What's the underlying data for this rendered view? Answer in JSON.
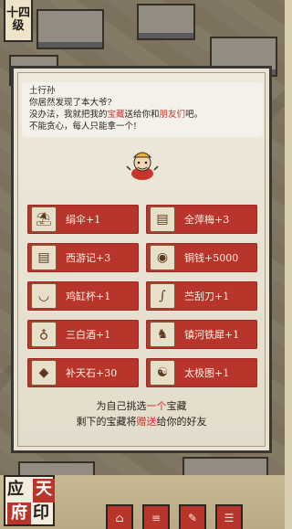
{
  "level_badge": {
    "line1": "十四",
    "line2": "级"
  },
  "dialog": {
    "speaker": "土行孙",
    "line1": "你居然发现了本大爷?",
    "line2_a": "没办法，我就把我的",
    "line2_red1": "宝藏",
    "line2_b": "送给你和",
    "line2_red2": "朋友们",
    "line2_c": "吧。",
    "line3": "不能贪心，每人只能拿一个!"
  },
  "items": [
    {
      "label": "绢伞+1",
      "icon": "umbrella-icon",
      "glyph": "⛱"
    },
    {
      "label": "全萍梅+3",
      "icon": "book-icon",
      "glyph": "▤"
    },
    {
      "label": "西游记+3",
      "icon": "book-icon",
      "glyph": "▤"
    },
    {
      "label": "铜钱+5000",
      "icon": "coin-icon",
      "glyph": "◉"
    },
    {
      "label": "鸡缸杯+1",
      "icon": "cup-icon",
      "glyph": "◡"
    },
    {
      "label": "苎刮刀+1",
      "icon": "blade-icon",
      "glyph": "∫"
    },
    {
      "label": "三白酒+1",
      "icon": "wine-gourd-icon",
      "glyph": "♁"
    },
    {
      "label": "镇河铁犀+1",
      "icon": "iron-rhino-icon",
      "glyph": "♞"
    },
    {
      "label": "补天石+30",
      "icon": "stone-icon",
      "glyph": "◆"
    },
    {
      "label": "太极图+1",
      "icon": "taiji-scroll-icon",
      "glyph": "☯"
    }
  ],
  "footer": {
    "line1_a": "为自己挑选",
    "line1_red": "一个",
    "line1_b": "宝藏",
    "line2_a": "剩下的宝藏将",
    "line2_red": "赠送",
    "line2_b": "给你的好友"
  },
  "seal": {
    "c1": "应",
    "c2": "天",
    "c3": "府",
    "c4": "印"
  },
  "colors": {
    "accent_red": "#b8352c",
    "text_red": "#c2332b",
    "panel": "#e9e2d1"
  }
}
